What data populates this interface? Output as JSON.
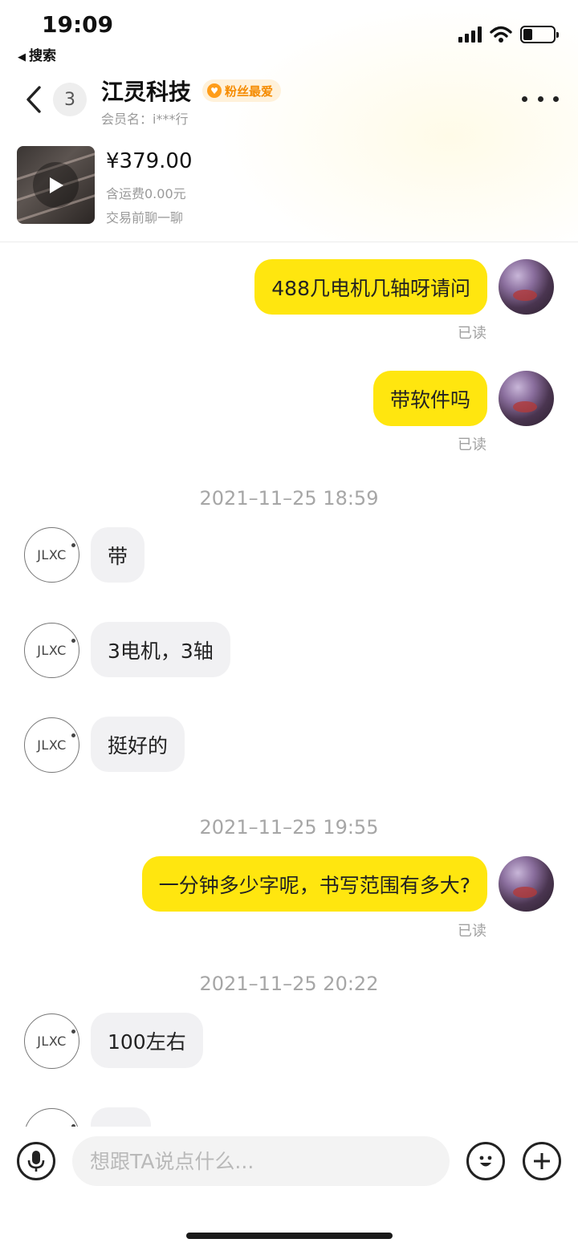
{
  "status_bar": {
    "time": "19:09",
    "back_app": "搜索"
  },
  "header": {
    "unread_count": "3",
    "shop_name": "江灵科技",
    "fan_badge": "粉丝最爱",
    "member_name": "会员名：i***行"
  },
  "product": {
    "price": "¥379.00",
    "shipping": "含运费0.00元",
    "pre_chat": "交易前聊一聊"
  },
  "messages": [
    {
      "type": "out",
      "text": "488几电机几轴呀请问",
      "read": "已读"
    },
    {
      "type": "out",
      "text": "带软件吗",
      "read": "已读"
    },
    {
      "type": "time",
      "text": "2021–11–25 18:59"
    },
    {
      "type": "in",
      "text": "带",
      "avatar": "JLXC"
    },
    {
      "type": "in",
      "text": "3电机，3轴",
      "avatar": "JLXC"
    },
    {
      "type": "in",
      "text": "挺好的",
      "avatar": "JLXC"
    },
    {
      "type": "time",
      "text": "2021–11–25 19:55"
    },
    {
      "type": "out",
      "text": "一分钟多少字呢，书写范围有多大?",
      "read": "已读"
    },
    {
      "type": "time",
      "text": "2021–11–25 20:22"
    },
    {
      "type": "in",
      "text": "100左右",
      "avatar": "JLXC"
    }
  ],
  "input_bar": {
    "placeholder": "想跟TA说点什么..."
  },
  "icons": {
    "back": "chevron-left-icon",
    "more": "more-dots-icon",
    "voice": "microphone-icon",
    "emoji": "emoji-icon",
    "add": "plus-icon",
    "play": "play-icon"
  },
  "colors": {
    "outgoing_bubble": "#ffe60f",
    "incoming_bubble": "#f1f1f3",
    "fan_badge": "#f58b00"
  }
}
